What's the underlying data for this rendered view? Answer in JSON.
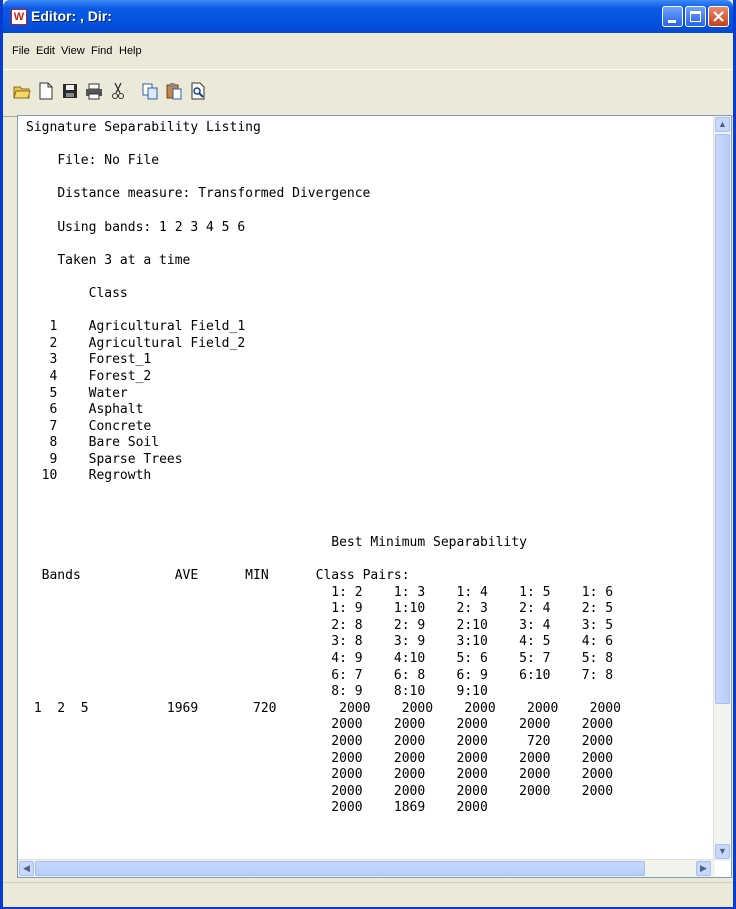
{
  "window": {
    "title": "Editor: , Dir:"
  },
  "menu": [
    "File",
    "Edit",
    "View",
    "Find",
    "Help"
  ],
  "toolbar": [
    "open-folder-icon",
    "new-document-icon",
    "save-icon",
    "print-icon",
    "cut-icon",
    "copy-icon",
    "paste-icon",
    "find-icon"
  ],
  "document": {
    "header": "Signature Separability Listing",
    "file_line": "File: No File",
    "distance_line": "Distance measure: Transformed Divergence",
    "bands_line": "Using bands: 1 2 3 4 5 6",
    "taken_line": "Taken 3 at a time",
    "class_heading": "Class",
    "classes": [
      {
        "id": "1",
        "name": "Agricultural Field_1"
      },
      {
        "id": "2",
        "name": "Agricultural Field_2"
      },
      {
        "id": "3",
        "name": "Forest_1"
      },
      {
        "id": "4",
        "name": "Forest_2"
      },
      {
        "id": "5",
        "name": "Water"
      },
      {
        "id": "6",
        "name": "Asphalt"
      },
      {
        "id": "7",
        "name": "Concrete"
      },
      {
        "id": "8",
        "name": "Bare Soil"
      },
      {
        "id": "9",
        "name": "Sparse Trees"
      },
      {
        "id": "10",
        "name": "Regrowth"
      }
    ],
    "best_title": "Best Minimum Separability",
    "col_bands": "Bands",
    "col_ave": "AVE",
    "col_min": "MIN",
    "col_pairs": "Class Pairs:",
    "pair_rows": [
      [
        "1: 2",
        "1: 3",
        "1: 4",
        "1: 5",
        "1: 6"
      ],
      [
        "1: 9",
        "1:10",
        "2: 3",
        "2: 4",
        "2: 5"
      ],
      [
        "2: 8",
        "2: 9",
        "2:10",
        "3: 4",
        "3: 5"
      ],
      [
        "3: 8",
        "3: 9",
        "3:10",
        "4: 5",
        "4: 6"
      ],
      [
        "4: 9",
        "4:10",
        "5: 6",
        "5: 7",
        "5: 8"
      ],
      [
        "6: 7",
        "6: 8",
        "6: 9",
        "6:10",
        "7: 8"
      ],
      [
        "8: 9",
        "8:10",
        "9:10"
      ]
    ],
    "result": {
      "bands": "1  2  5",
      "ave": "1969",
      "min": "720",
      "value_rows": [
        [
          "2000",
          "2000",
          "2000",
          "2000",
          "2000"
        ],
        [
          "2000",
          "2000",
          "2000",
          "2000",
          "2000"
        ],
        [
          "2000",
          "2000",
          "2000",
          "720",
          "2000"
        ],
        [
          "2000",
          "2000",
          "2000",
          "2000",
          "2000"
        ],
        [
          "2000",
          "2000",
          "2000",
          "2000",
          "2000"
        ],
        [
          "2000",
          "2000",
          "2000",
          "2000",
          "2000"
        ],
        [
          "2000",
          "1869",
          "2000"
        ]
      ]
    }
  }
}
